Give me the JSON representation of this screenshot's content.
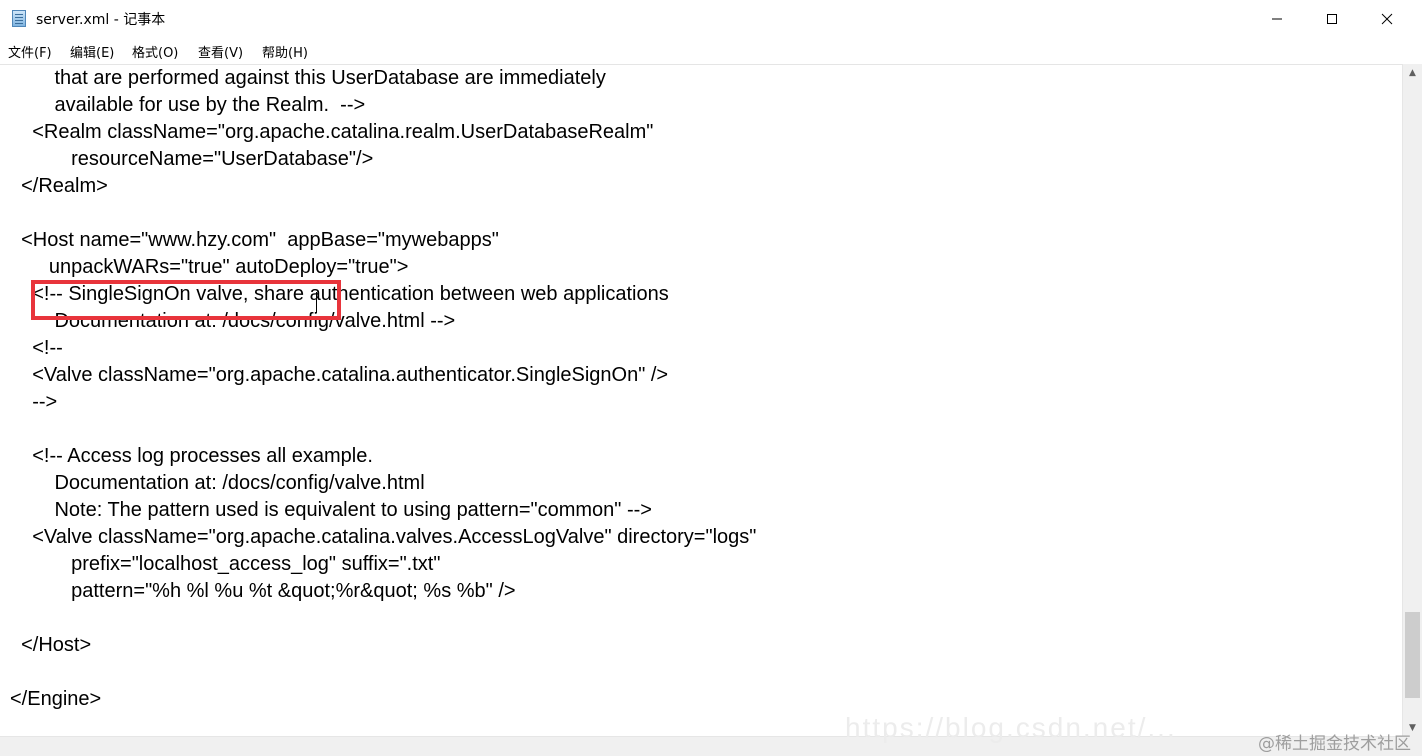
{
  "window": {
    "title": "server.xml - 记事本",
    "icon": "notepad-icon",
    "controls": {
      "minimize_icon": "minimize-icon",
      "maximize_icon": "maximize-icon",
      "close_icon": "close-icon"
    }
  },
  "menu": {
    "items": [
      {
        "label": "文件(F)"
      },
      {
        "label": "编辑(E)"
      },
      {
        "label": "格式(O)"
      },
      {
        "label": "查看(V)"
      },
      {
        "label": "帮助(H)"
      }
    ]
  },
  "editor": {
    "lines": [
      "        that are performed against this UserDatabase are immediately",
      "        available for use by the Realm.  -->",
      "    <Realm className=\"org.apache.catalina.realm.UserDatabaseRealm\"",
      "           resourceName=\"UserDatabase\"/>",
      "  </Realm>",
      "",
      "  <Host name=\"www.hzy.com\"  appBase=\"mywebapps\"",
      "       unpackWARs=\"true\" autoDeploy=\"true\">",
      "    <!-- SingleSignOn valve, share authentication between web applications",
      "        Documentation at: /docs/config/valve.html -->",
      "    <!--",
      "    <Valve className=\"org.apache.catalina.authenticator.SingleSignOn\" />",
      "    -->",
      "",
      "    <!-- Access log processes all example.",
      "        Documentation at: /docs/config/valve.html",
      "        Note: The pattern used is equivalent to using pattern=\"common\" -->",
      "    <Valve className=\"org.apache.catalina.valves.AccessLogValve\" directory=\"logs\"",
      "           prefix=\"localhost_access_log\" suffix=\".txt\"",
      "           pattern=\"%h %l %u %t &quot;%r&quot; %s %b\" />",
      "",
      "  </Host>",
      "",
      "</Engine>"
    ]
  },
  "colors": {
    "highlight_border": "#e8343b"
  },
  "watermark": {
    "url": "https://blog.csdn.net/...",
    "brand": "@稀土掘金技术社区"
  }
}
